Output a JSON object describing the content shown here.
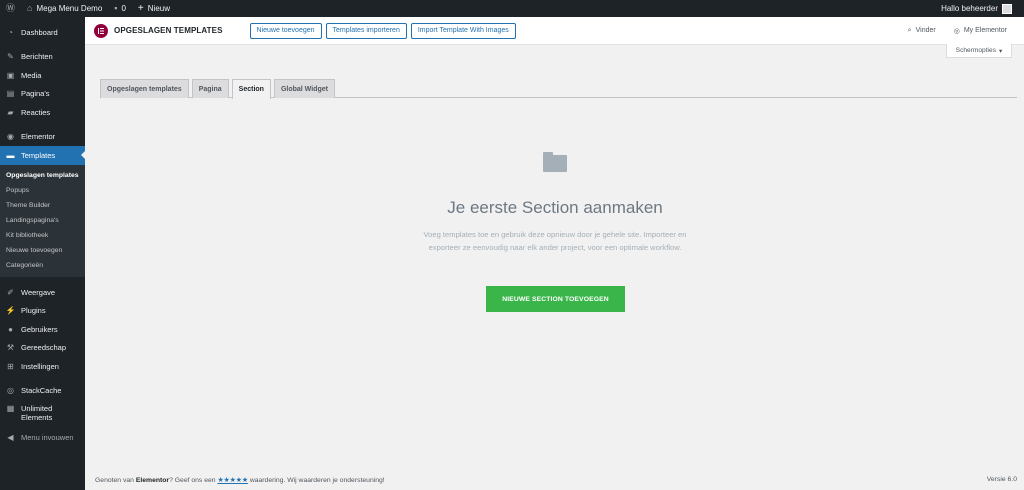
{
  "adminbar": {
    "site_name": "Mega Menu Demo",
    "comments_count": "0",
    "new_label": "Nieuw",
    "greeting": "Hallo beheerder"
  },
  "sidebar": {
    "items": [
      {
        "label": "Dashboard",
        "icon": "dashboard-icon"
      },
      {
        "label": "Berichten",
        "icon": "pin-icon"
      },
      {
        "label": "Media",
        "icon": "media-icon"
      },
      {
        "label": "Pagina's",
        "icon": "page-icon"
      },
      {
        "label": "Reacties",
        "icon": "comment-icon"
      },
      {
        "label": "Elementor",
        "icon": "elementor-icon"
      },
      {
        "label": "Templates",
        "icon": "folder-icon"
      }
    ],
    "submenu": [
      "Opgeslagen templates",
      "Popups",
      "Theme Builder",
      "Landingspagina's",
      "Kit bibliotheek",
      "Nieuwe toevoegen",
      "Categorieën"
    ],
    "items2": [
      {
        "label": "Weergave",
        "icon": "brush-icon"
      },
      {
        "label": "Plugins",
        "icon": "plugin-icon"
      },
      {
        "label": "Gebruikers",
        "icon": "users-icon"
      },
      {
        "label": "Gereedschap",
        "icon": "wrench-icon"
      },
      {
        "label": "Instellingen",
        "icon": "settings-icon"
      }
    ],
    "items3": [
      {
        "label": "StackCache",
        "icon": "cache-icon"
      },
      {
        "label": "Unlimited Elements",
        "icon": "elements-icon"
      },
      {
        "label": "Menu invouwen",
        "icon": "collapse-icon"
      }
    ]
  },
  "header": {
    "title": "OPGESLAGEN TEMPLATES",
    "buttons": [
      "Nieuwe toevoegen",
      "Templates importeren",
      "Import Template With Images"
    ],
    "finder": "Vinder",
    "my_elementor": "My Elementor"
  },
  "screen_options": "Schermopties",
  "tabs": [
    "Opgeslagen templates",
    "Pagina",
    "Section",
    "Global Widget"
  ],
  "empty": {
    "title": "Je eerste Section aanmaken",
    "description": "Voeg templates toe en gebruik deze opnieuw door je gehele site. Importeer en exporteer ze eenvoudig naar elk ander project, voor een optimale workflow.",
    "cta": "NIEUWE SECTION TOEVOEGEN"
  },
  "footer": {
    "prefix": "Genoten van",
    "brand": "Elementor",
    "mid": "? Geef ons een",
    "stars": "★★★★★",
    "suffix": "waardering. Wij waarderen je ondersteuning!",
    "version": "Versie 6.0"
  },
  "colors": {
    "accent": "#2271b1",
    "admin_dark": "#1d2327",
    "cta_green": "#39b54a",
    "elementor_brand": "#92003b"
  }
}
